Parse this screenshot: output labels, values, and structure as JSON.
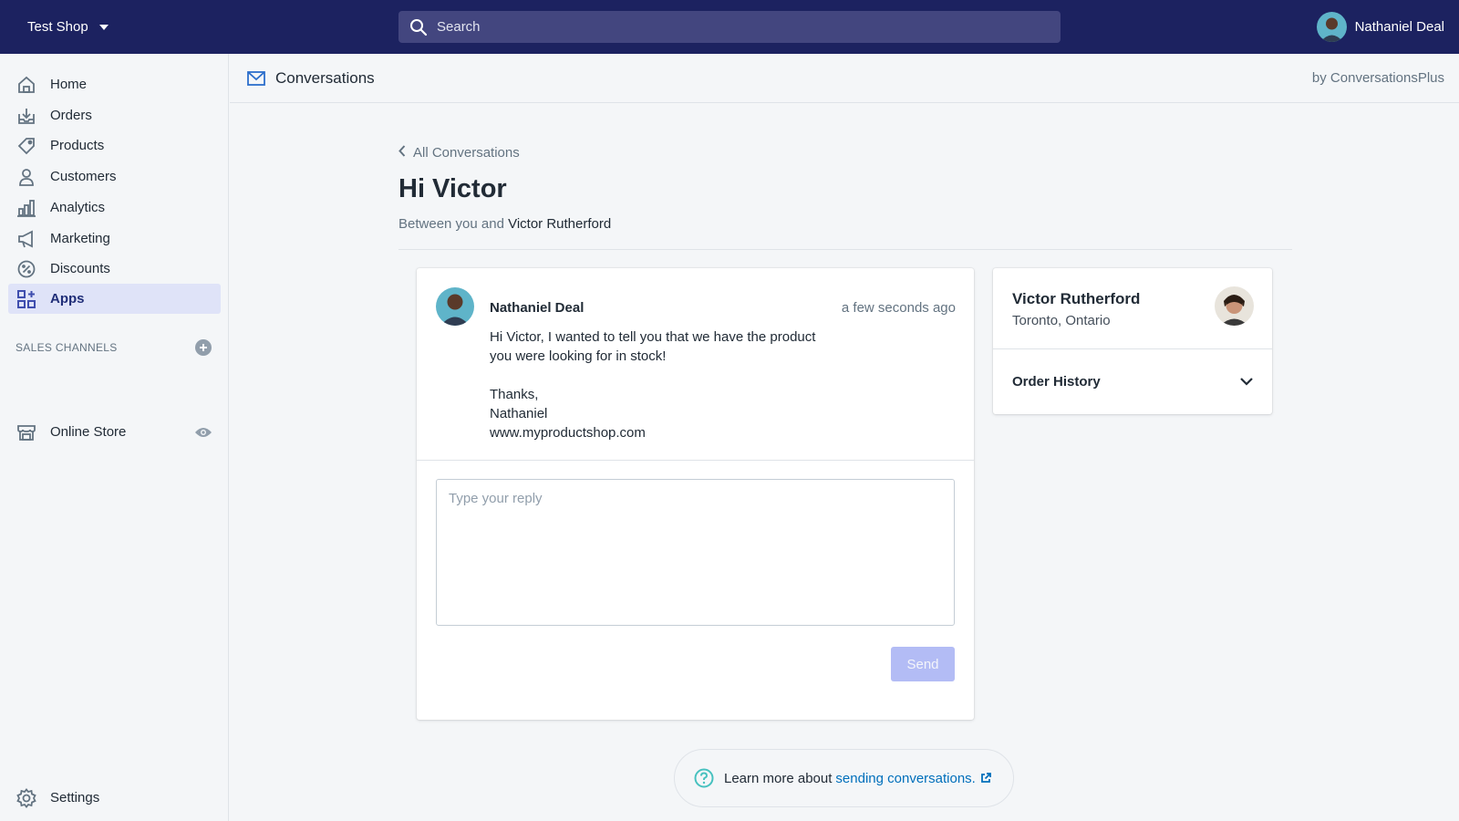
{
  "topbar": {
    "shop_name": "Test Shop",
    "search_placeholder": "Search",
    "user_name": "Nathaniel Deal"
  },
  "sidebar": {
    "items": [
      {
        "label": "Home",
        "icon": "home-icon"
      },
      {
        "label": "Orders",
        "icon": "orders-icon"
      },
      {
        "label": "Products",
        "icon": "tag-icon"
      },
      {
        "label": "Customers",
        "icon": "person-icon"
      },
      {
        "label": "Analytics",
        "icon": "bar-chart-icon"
      },
      {
        "label": "Marketing",
        "icon": "megaphone-icon"
      },
      {
        "label": "Discounts",
        "icon": "discount-icon"
      },
      {
        "label": "Apps",
        "icon": "apps-icon",
        "active": true
      }
    ],
    "sales_channels_heading": "SALES CHANNELS",
    "online_store": "Online Store",
    "settings": "Settings"
  },
  "app_header": {
    "title": "Conversations",
    "by": "by ConversationsPlus"
  },
  "page": {
    "back_link": "All Conversations",
    "title": "Hi Victor",
    "between_prefix": "Between you and",
    "between_name": "Victor Rutherford"
  },
  "message": {
    "from": "Nathaniel Deal",
    "time": "a few seconds ago",
    "body": "Hi Victor, I wanted to tell you that we have the product you were looking for in stock!\n\nThanks,\nNathaniel\nwww.myproductshop.com",
    "reply_placeholder": "Type your reply",
    "send_label": "Send"
  },
  "customer": {
    "name": "Victor Rutherford",
    "location": "Toronto, Ontario",
    "order_history_label": "Order History"
  },
  "help": {
    "prefix": "Learn more about",
    "link": "sending conversations."
  },
  "colors": {
    "topbar": "#1c2260",
    "search_bg": "#43467f",
    "active_nav_bg": "#dfe3f8",
    "active_nav_text": "#202e78",
    "send_disabled": "#b3bcf5",
    "link": "#006fbb",
    "help_icon": "#47c1bf"
  }
}
